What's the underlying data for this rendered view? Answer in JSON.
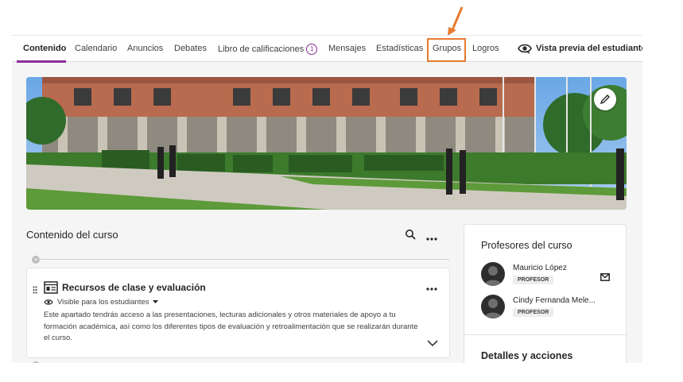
{
  "nav": {
    "tabs": [
      {
        "label": "Contenido"
      },
      {
        "label": "Calendario"
      },
      {
        "label": "Anuncios"
      },
      {
        "label": "Debates"
      },
      {
        "label": "Libro de calificaciones",
        "badge": "1"
      },
      {
        "label": "Mensajes"
      },
      {
        "label": "Estadísticas"
      },
      {
        "label": "Grupos"
      },
      {
        "label": "Logros"
      }
    ],
    "student_preview": "Vista previa del estudiante"
  },
  "content": {
    "title": "Contenido del curso",
    "item": {
      "title": "Recursos de clase y evaluación",
      "visibility": "Visible para los estudiantes",
      "description": "Este apartado tendrás acceso a las presentaciones, lecturas adicionales y otros materiales de apoyo a tu formación académica, así como los diferentes tipos de evaluación y retroalimentación que se realizarán durante el curso."
    }
  },
  "sidebar": {
    "professors_title": "Profesores del curso",
    "professors": [
      {
        "name": "Mauricio López",
        "role": "PROFESOR"
      },
      {
        "name": "Cindy Fernanda Mele...",
        "role": "PROFESOR"
      }
    ],
    "details_title": "Detalles y acciones"
  },
  "colors": {
    "accent": "#8a2c99",
    "highlight": "#e77b30"
  },
  "icons": [
    "eye-icon",
    "pencil-icon",
    "search-icon",
    "more-icon",
    "drag-handle-icon",
    "document-icon",
    "caret-down-icon",
    "chevron-down-icon",
    "mail-icon",
    "plus-icon"
  ]
}
